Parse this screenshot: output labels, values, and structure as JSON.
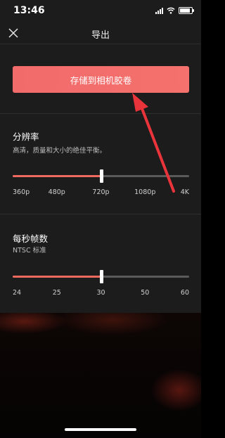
{
  "status_bar": {
    "time": "13:46"
  },
  "header": {
    "title": "导出"
  },
  "save_button": {
    "label": "存储到相机胶卷"
  },
  "resolution": {
    "title": "分辨率",
    "subtitle": "高清，质量和大小的绝佳平衡。",
    "ticks": [
      "360p",
      "480p",
      "720p",
      "1080p",
      "4K"
    ],
    "selected": "720p",
    "selected_index": 2
  },
  "fps": {
    "title": "每秒帧数",
    "subtitle": "NTSC 标准",
    "ticks": [
      "24",
      "25",
      "30",
      "50",
      "60"
    ],
    "selected": "30",
    "selected_index": 2
  },
  "colors": {
    "accent": "#f16b6b",
    "panel_bg": "#1c1c1c",
    "track_bg": "#5a5a5a",
    "arrow": "#e8343a"
  },
  "icons": {
    "close": "close-icon",
    "signal": "signal-icon",
    "wifi": "wifi-icon",
    "battery": "battery-icon",
    "annotation": "arrow-annotation"
  }
}
